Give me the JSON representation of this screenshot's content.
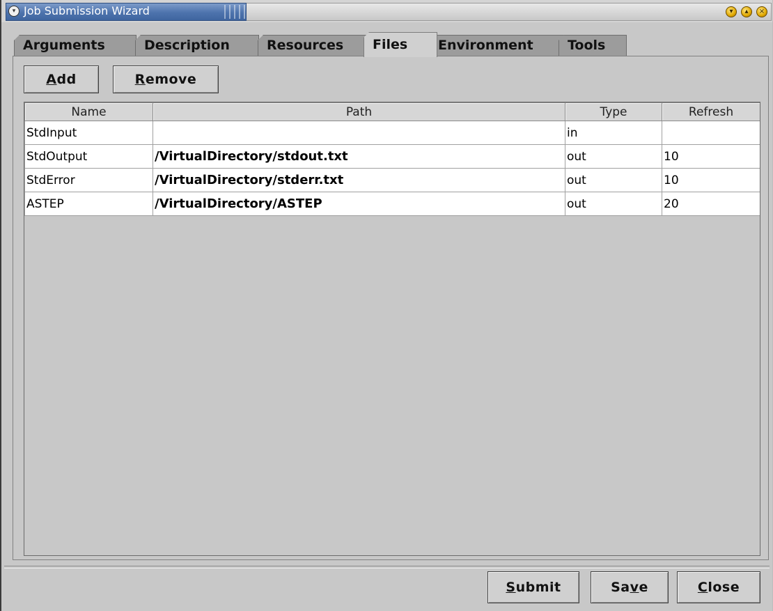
{
  "window": {
    "title": "Job Submission Wizard"
  },
  "tabs": [
    {
      "label": "Arguments"
    },
    {
      "label": "Description"
    },
    {
      "label": "Resources"
    },
    {
      "label": "Files"
    },
    {
      "label": "Environment"
    },
    {
      "label": "Tools"
    }
  ],
  "selected_tab": "Files",
  "toolbar": {
    "add_mnemonic": "A",
    "add_rest": "dd",
    "remove_mnemonic": "R",
    "remove_rest": "emove"
  },
  "table": {
    "columns": [
      "Name",
      "Path",
      "Type",
      "Refresh"
    ],
    "rows": [
      {
        "name": "StdInput",
        "path": "",
        "type": "in",
        "refresh": ""
      },
      {
        "name": "StdOutput",
        "path": "/VirtualDirectory/stdout.txt",
        "type": "out",
        "refresh": "10"
      },
      {
        "name": "StdError",
        "path": "/VirtualDirectory/stderr.txt",
        "type": "out",
        "refresh": "10"
      },
      {
        "name": "ASTEP",
        "path": "/VirtualDirectory/ASTEP",
        "type": "out",
        "refresh": "20"
      }
    ]
  },
  "footer": {
    "submit_mnemonic": "S",
    "submit_rest": "ubmit",
    "save_pre": "Sa",
    "save_mnemonic": "v",
    "save_post": "e",
    "close_mnemonic": "C",
    "close_rest": "lose"
  },
  "icons": {
    "window_menu": "chevron-down-icon",
    "minimize": "minimize-icon",
    "maximize": "maximize-icon",
    "close": "close-icon"
  }
}
